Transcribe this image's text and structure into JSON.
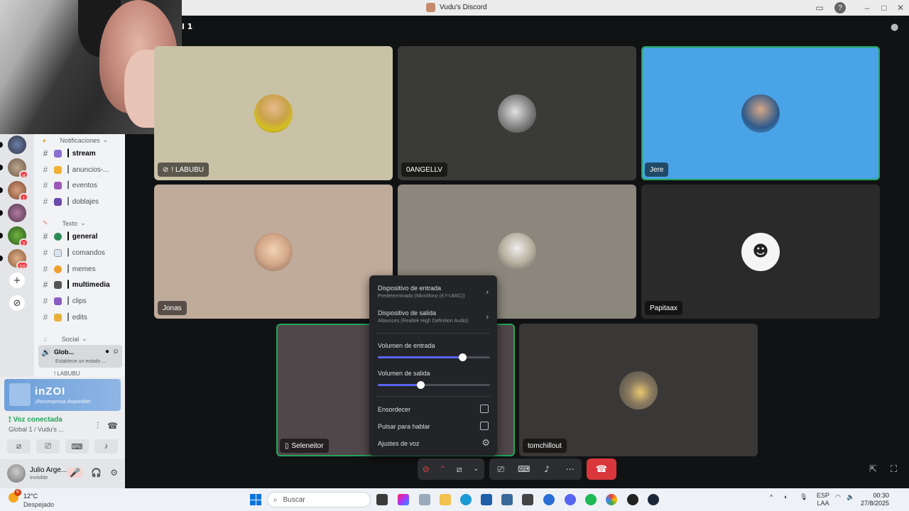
{
  "window": {
    "title": "Vudu's Discord"
  },
  "channel": {
    "name_fragment": "l 1"
  },
  "rail": {
    "badges": [
      "4",
      "1",
      "2",
      "10"
    ]
  },
  "sidebar": {
    "categories": {
      "notificaciones": "Notificaciones",
      "texto": "Texto",
      "social": "Social"
    },
    "channels": [
      {
        "label": "┃ stream",
        "bold": true
      },
      {
        "label": "┃ anuncios-...",
        "bold": false
      },
      {
        "label": "┃ eventos",
        "bold": false
      },
      {
        "label": "┃ doblajes",
        "bold": false
      },
      {
        "label": "┃ general",
        "bold": true
      },
      {
        "label": "┃ comandos",
        "bold": false
      },
      {
        "label": "┃ memes",
        "bold": false
      },
      {
        "label": "┃ multimedia",
        "bold": true
      },
      {
        "label": "┃ clips",
        "bold": false
      },
      {
        "label": "┃ edits",
        "bold": false
      }
    ],
    "voice_channel": {
      "name": "Glob...",
      "status": "Establece un estado ...",
      "user": "! LABUBU"
    }
  },
  "promo": {
    "logo": "inZOI",
    "subtitle": "¡Recompensa disponible!"
  },
  "voice_panel": {
    "status": "Voz conectada",
    "location": "Global 1 / Vudu's ..."
  },
  "user": {
    "name": "Julio Arge...",
    "status": "Invisible"
  },
  "tiles": [
    {
      "name": "! LABUBU",
      "muted": true
    },
    {
      "name": "0ANGELLV"
    },
    {
      "name": "Jere"
    },
    {
      "name": "Jonas"
    },
    {
      "name": ""
    },
    {
      "name": "Papitaax"
    },
    {
      "name": "Seleneitor"
    },
    {
      "name": "tomchillout"
    }
  ],
  "popup": {
    "input_device": {
      "label": "Dispositivo de entrada",
      "value": "Predeterminado (Micrófono (KY-UMIC))"
    },
    "output_device": {
      "label": "Dispositivo de salida",
      "value": "Altavoces (Realtek High Definition Audio)"
    },
    "input_volume": {
      "label": "Volumen de entrada",
      "value": 0.75
    },
    "output_volume": {
      "label": "Volumen de salida",
      "value": 0.38
    },
    "deafen": "Ensordecer",
    "push_to_talk": "Pulsar para hablar",
    "voice_settings": "Ajustes de voz"
  },
  "taskbar": {
    "weather_temp": "12°C",
    "weather_desc": "Despejado",
    "weather_badge": "6",
    "search_placeholder": "Buscar",
    "lang_top": "ESP",
    "lang_bottom": "LAA",
    "time": "00:30",
    "date": "27/8/2025"
  }
}
